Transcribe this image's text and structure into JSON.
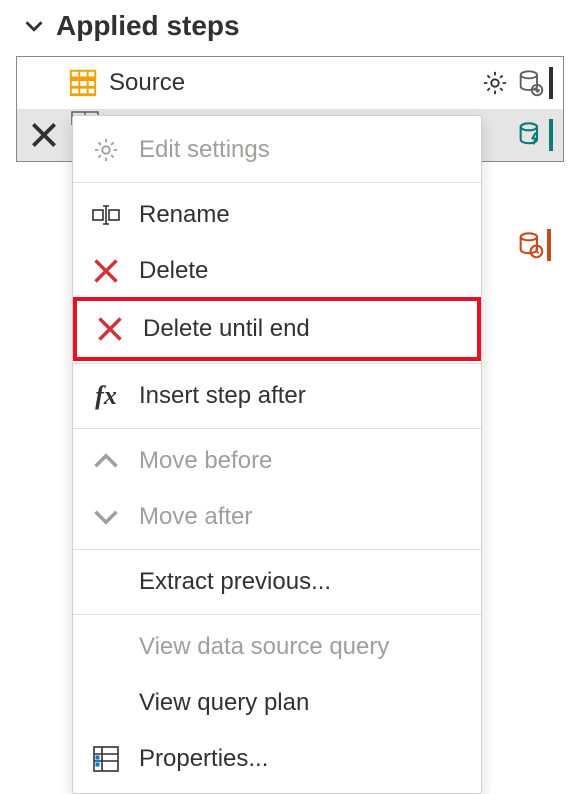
{
  "header": {
    "title": "Applied steps"
  },
  "steps": [
    {
      "label": "Source"
    }
  ],
  "menu": {
    "editSettings": "Edit settings",
    "rename": "Rename",
    "delete": "Delete",
    "deleteUntilEnd": "Delete until end",
    "insertStepAfter": "Insert step after",
    "moveBefore": "Move before",
    "moveAfter": "Move after",
    "extractPrevious": "Extract previous...",
    "viewDataSourceQuery": "View data source query",
    "viewQueryPlan": "View query plan",
    "properties": "Properties..."
  }
}
